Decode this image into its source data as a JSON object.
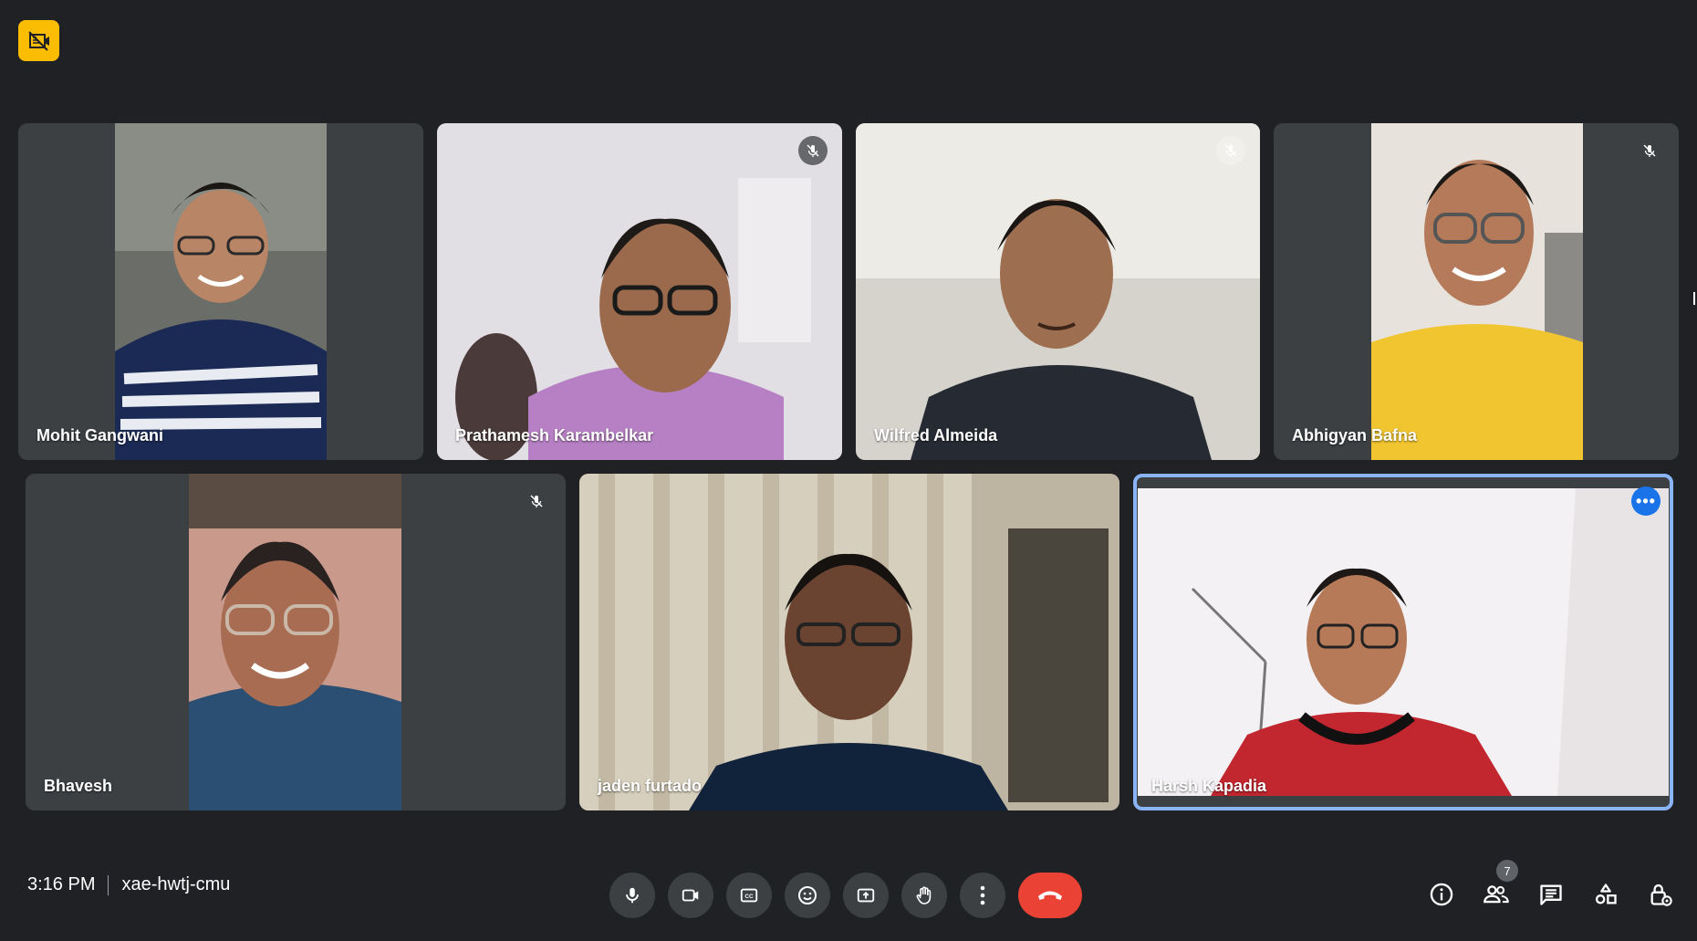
{
  "meeting": {
    "time": "3:16 PM",
    "code": "xae-hwtj-cmu",
    "participant_count": "7"
  },
  "participants": [
    {
      "name": "Mohit Gangwani",
      "muted": false
    },
    {
      "name": "Prathamesh Karambelkar",
      "muted": true
    },
    {
      "name": "Wilfred Almeida",
      "muted": true
    },
    {
      "name": "Abhigyan Bafna",
      "muted": true
    },
    {
      "name": "Bhavesh",
      "muted": true
    },
    {
      "name": "jaden furtado",
      "muted": false
    },
    {
      "name": "Harsh Kapadia",
      "muted": false,
      "selected": true
    }
  ],
  "icons": {
    "recording": "recording-off-icon",
    "controls": [
      "microphone-icon",
      "camera-icon",
      "captions-icon",
      "emoji-icon",
      "present-screen-icon",
      "raise-hand-icon",
      "more-options-icon",
      "end-call-icon"
    ],
    "right": [
      "info-icon",
      "people-icon",
      "chat-icon",
      "activities-icon",
      "host-controls-icon"
    ]
  },
  "colors": {
    "background": "#202124",
    "tile": "#3c4043",
    "accent": "#1a73e8",
    "end_call": "#ea4335",
    "recording_badge": "#fbbc04",
    "selected_outline": "#8ab4f8"
  }
}
